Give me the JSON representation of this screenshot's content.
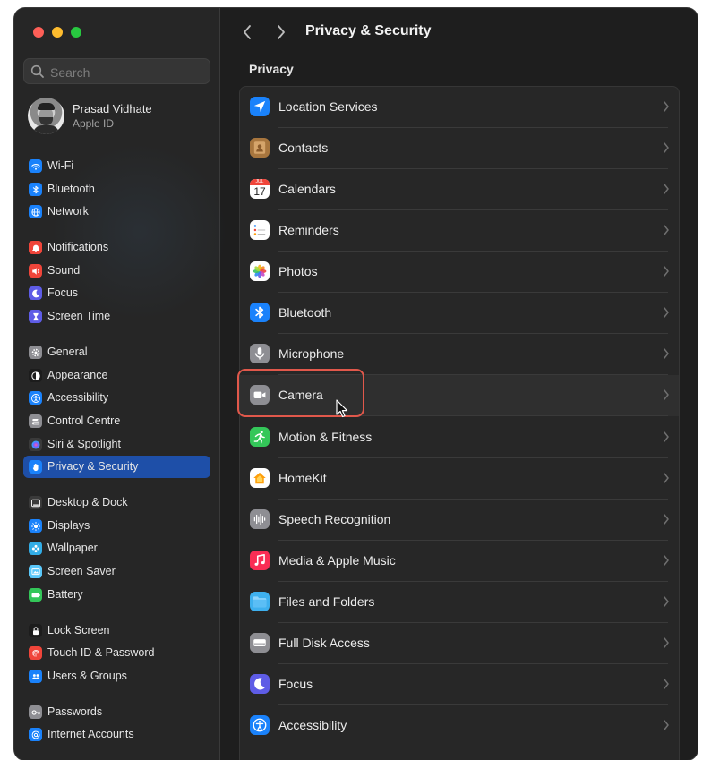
{
  "window": {
    "title": "Privacy & Security"
  },
  "search": {
    "placeholder": "Search",
    "value": ""
  },
  "profile": {
    "name": "Prasad Vidhate",
    "subtitle": "Apple ID"
  },
  "sidebar": {
    "items": [
      {
        "id": "wifi",
        "label": "Wi-Fi",
        "icon": "wifi-icon",
        "color": "#1a82fb",
        "selected": false
      },
      {
        "id": "bluetooth",
        "label": "Bluetooth",
        "icon": "bluetooth-icon",
        "color": "#1a82fb",
        "selected": false
      },
      {
        "id": "network",
        "label": "Network",
        "icon": "globe-icon",
        "color": "#1a82fb",
        "selected": false
      },
      {
        "id": "notifications",
        "label": "Notifications",
        "icon": "bell-icon",
        "color": "#f0453a",
        "selected": false
      },
      {
        "id": "sound",
        "label": "Sound",
        "icon": "speaker-icon",
        "color": "#f0453a",
        "selected": false
      },
      {
        "id": "focus",
        "label": "Focus",
        "icon": "moon-icon",
        "color": "#5e5ce6",
        "selected": false
      },
      {
        "id": "screen-time",
        "label": "Screen Time",
        "icon": "hourglass-icon",
        "color": "#5e5ce6",
        "selected": false
      },
      {
        "id": "general",
        "label": "General",
        "icon": "gear-icon",
        "color": "#8e8e93",
        "selected": false
      },
      {
        "id": "appearance",
        "label": "Appearance",
        "icon": "appearance-icon",
        "color": "#1c1c1c",
        "selected": false
      },
      {
        "id": "accessibility",
        "label": "Accessibility",
        "icon": "accessibility-icon",
        "color": "#1a82fb",
        "selected": false
      },
      {
        "id": "control-centre",
        "label": "Control Centre",
        "icon": "control-centre-icon",
        "color": "#8e8e93",
        "selected": false
      },
      {
        "id": "siri",
        "label": "Siri & Spotlight",
        "icon": "siri-icon",
        "color": "#3a3a3a",
        "selected": false
      },
      {
        "id": "privacy",
        "label": "Privacy & Security",
        "icon": "hand-icon",
        "color": "#1a82fb",
        "selected": true
      },
      {
        "id": "desktop-dock",
        "label": "Desktop & Dock",
        "icon": "dock-icon",
        "color": "#3a3a3a",
        "selected": false
      },
      {
        "id": "displays",
        "label": "Displays",
        "icon": "sun-icon",
        "color": "#1a82fb",
        "selected": false
      },
      {
        "id": "wallpaper",
        "label": "Wallpaper",
        "icon": "flower-icon",
        "color": "#32ade6",
        "selected": false
      },
      {
        "id": "screen-saver",
        "label": "Screen Saver",
        "icon": "screensaver-icon",
        "color": "#5ac8fa",
        "selected": false
      },
      {
        "id": "battery",
        "label": "Battery",
        "icon": "battery-icon",
        "color": "#34c759",
        "selected": false
      },
      {
        "id": "lock-screen",
        "label": "Lock Screen",
        "icon": "lock-icon",
        "color": "#1c1c1c",
        "selected": false
      },
      {
        "id": "touch-id",
        "label": "Touch ID & Password",
        "icon": "fingerprint-icon",
        "color": "#f0453a",
        "selected": false
      },
      {
        "id": "users-groups",
        "label": "Users & Groups",
        "icon": "users-icon",
        "color": "#1a82fb",
        "selected": false
      },
      {
        "id": "passwords",
        "label": "Passwords",
        "icon": "key-icon",
        "color": "#8e8e93",
        "selected": false
      },
      {
        "id": "internet-accounts",
        "label": "Internet Accounts",
        "icon": "at-icon",
        "color": "#1a82fb",
        "selected": false
      }
    ]
  },
  "main": {
    "section_label": "Privacy",
    "rows": [
      {
        "label": "Location Services",
        "icon": "location-arrow-icon",
        "color": "#1a82fb",
        "highlight": false
      },
      {
        "label": "Contacts",
        "icon": "contacts-icon",
        "color": "#a8763e",
        "highlight": false
      },
      {
        "label": "Calendars",
        "icon": "calendar-icon",
        "color": "#ffffff",
        "highlight": false,
        "calendar_month": "JUL",
        "calendar_day": "17"
      },
      {
        "label": "Reminders",
        "icon": "reminders-icon",
        "color": "#ffffff",
        "highlight": false
      },
      {
        "label": "Photos",
        "icon": "photos-icon",
        "color": "#ffffff",
        "highlight": false
      },
      {
        "label": "Bluetooth",
        "icon": "bluetooth-icon",
        "color": "#1a82fb",
        "highlight": false
      },
      {
        "label": "Microphone",
        "icon": "microphone-icon",
        "color": "#8e8e93",
        "highlight": false
      },
      {
        "label": "Camera",
        "icon": "camera-icon",
        "color": "#8e8e93",
        "highlight": true
      },
      {
        "label": "Motion & Fitness",
        "icon": "running-icon",
        "color": "#34c759",
        "highlight": false
      },
      {
        "label": "HomeKit",
        "icon": "home-icon",
        "color": "#ffffff",
        "highlight": false
      },
      {
        "label": "Speech Recognition",
        "icon": "waveform-icon",
        "color": "#8e8e93",
        "highlight": false
      },
      {
        "label": "Media & Apple Music",
        "icon": "music-icon",
        "color": "#fa2d55",
        "highlight": false
      },
      {
        "label": "Files and Folders",
        "icon": "folder-icon",
        "color": "#3eb0ee",
        "highlight": false
      },
      {
        "label": "Full Disk Access",
        "icon": "disk-icon",
        "color": "#8e8e93",
        "highlight": false
      },
      {
        "label": "Focus",
        "icon": "moon-icon",
        "color": "#5e5ce6",
        "highlight": false
      },
      {
        "label": "Accessibility",
        "icon": "accessibility-icon",
        "color": "#1a82fb",
        "highlight": false
      }
    ]
  },
  "accent_color": "#1e4fa8",
  "annotation_color": "#e1584b"
}
